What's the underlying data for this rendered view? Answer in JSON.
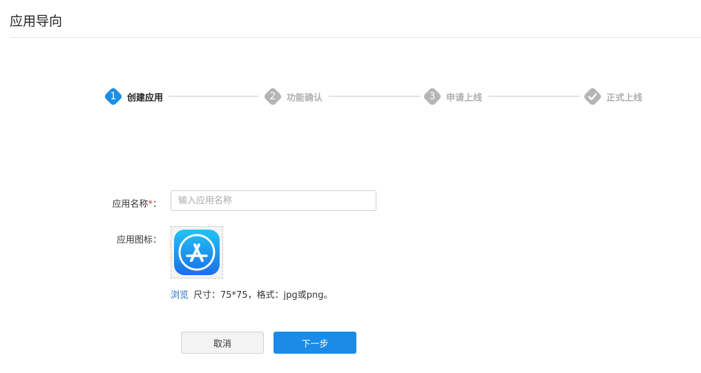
{
  "page": {
    "title": "应用导向"
  },
  "steps": [
    {
      "number": "1",
      "label": "创建应用",
      "state": "active"
    },
    {
      "number": "2",
      "label": "功能确认",
      "state": "pending"
    },
    {
      "number": "3",
      "label": "申请上线",
      "state": "pending"
    },
    {
      "number": "",
      "label": "正式上线",
      "state": "pending",
      "icon": "checkmark-icon"
    }
  ],
  "form": {
    "name_label": "应用名称",
    "name_required_mark": "*",
    "name_colon": "：",
    "name_placeholder": "输入应用名称",
    "name_value": "",
    "icon_label": "应用图标：",
    "icon_image": "app-store-icon",
    "browse_label": "浏览",
    "icon_hint": "尺寸：75*75，格式：jpg或png。"
  },
  "buttons": {
    "cancel_label": "取消",
    "next_label": "下一步"
  },
  "colors": {
    "accent": "#1a8be6",
    "inactive_step": "#b5b5b5",
    "required": "#e62e2e",
    "link": "#2a73c2"
  }
}
